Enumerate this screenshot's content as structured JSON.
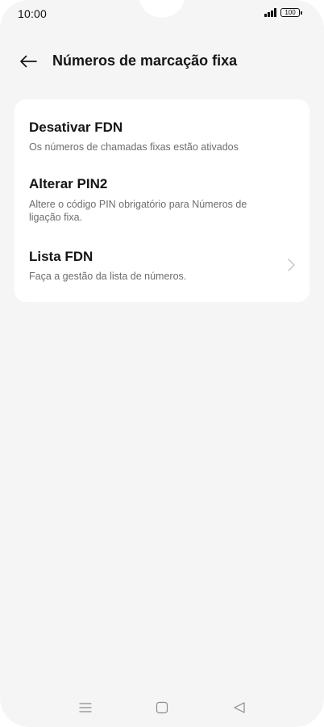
{
  "status_bar": {
    "time": "10:00",
    "battery": "100"
  },
  "header": {
    "back_icon": "arrow-left-icon",
    "title": "Números de marcação fixa"
  },
  "settings": {
    "items": [
      {
        "title": "Desativar FDN",
        "subtitle": "Os números de chamadas fixas estão ativados"
      },
      {
        "title": "Alterar PIN2",
        "subtitle": "Altere o código PIN obrigatório para Números de ligação fixa."
      },
      {
        "title": "Lista FDN",
        "subtitle": "Faça a gestão da lista de números.",
        "trailing_icon": "chevron-right-icon"
      }
    ]
  },
  "nav_bar": {
    "icons": [
      "menu-icon",
      "home-square-icon",
      "back-triangle-icon"
    ]
  },
  "colors": {
    "background": "#f5f5f5",
    "card": "#ffffff",
    "title_text": "#151515",
    "secondary_text": "#6d6d6d"
  }
}
